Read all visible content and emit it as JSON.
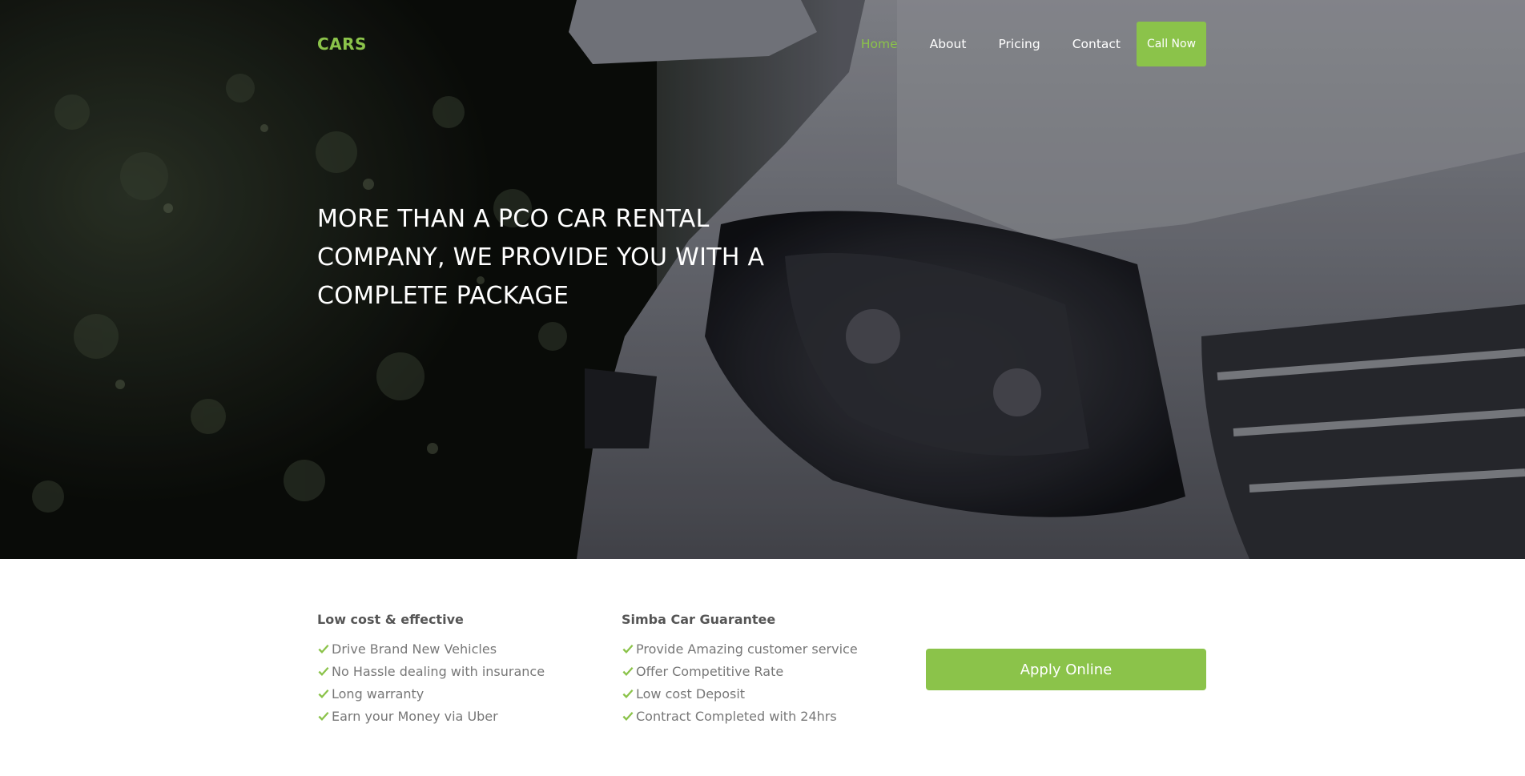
{
  "brand": {
    "name": "CARS",
    "accent_color": "#8bc34a"
  },
  "nav": {
    "items": [
      {
        "label": "Home",
        "active": true
      },
      {
        "label": "About",
        "active": false
      },
      {
        "label": "Pricing",
        "active": false
      },
      {
        "label": "Contact",
        "active": false
      }
    ],
    "cta_label": "Call Now"
  },
  "hero": {
    "headline_lines": [
      "MORE THAN A PCO CAR RENTAL",
      "COMPANY, WE PROVIDE YOU WITH A",
      "COMPLETE PACKAGE"
    ],
    "image": "car-headlight-photo"
  },
  "features": {
    "left": {
      "title": "Low cost & effective",
      "items": [
        "Drive Brand New Vehicles",
        "No Hassle dealing with insurance",
        "Long warranty",
        "Earn your Money via Uber"
      ]
    },
    "right": {
      "title": "Simba Car Guarantee",
      "items": [
        "Provide Amazing customer service",
        "Offer Competitive Rate",
        "Low cost Deposit",
        "Contract Completed with 24hrs"
      ]
    },
    "apply_label": "Apply Online",
    "check_icon": "check-icon"
  }
}
